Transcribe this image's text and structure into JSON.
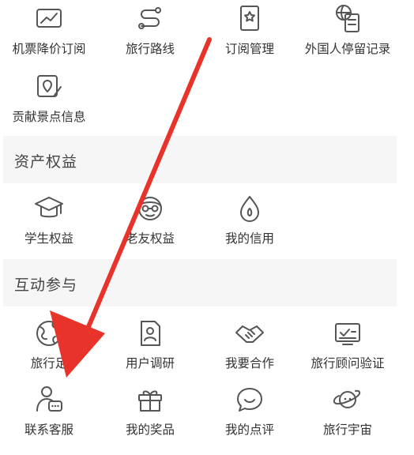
{
  "services": {
    "row1": [
      {
        "label": "机票降价订阅",
        "icon": "price-trend-icon"
      },
      {
        "label": "旅行路线",
        "icon": "route-icon"
      },
      {
        "label": "订阅管理",
        "icon": "bookmark-star-icon"
      },
      {
        "label": "外国人停留记录",
        "icon": "globe-document-icon"
      }
    ],
    "row2": [
      {
        "label": "贡献景点信息",
        "icon": "location-edit-icon"
      }
    ]
  },
  "assets": {
    "title": "资产权益",
    "items": [
      {
        "label": "学生权益",
        "icon": "graduation-cap-icon"
      },
      {
        "label": "老友权益",
        "icon": "elder-face-icon"
      },
      {
        "label": "我的信用",
        "icon": "credit-drop-icon"
      }
    ]
  },
  "interaction": {
    "title": "互动参与",
    "row1": [
      {
        "label": "旅行足",
        "icon": "globe-footprint-icon"
      },
      {
        "label": "用户调研",
        "icon": "survey-icon"
      },
      {
        "label": "我要合作",
        "icon": "handshake-icon"
      },
      {
        "label": "旅行顾问验证",
        "icon": "verified-card-icon"
      }
    ],
    "row2": [
      {
        "label": "联系客服",
        "icon": "customer-service-icon"
      },
      {
        "label": "我的奖品",
        "icon": "gift-icon"
      },
      {
        "label": "我的点评",
        "icon": "review-bubble-icon"
      },
      {
        "label": "旅行宇宙",
        "icon": "planet-icon"
      }
    ]
  },
  "colors": {
    "annotation_arrow": "#e8332a",
    "section_bg": "#f6f6f6",
    "icon_stroke": "#555555"
  }
}
